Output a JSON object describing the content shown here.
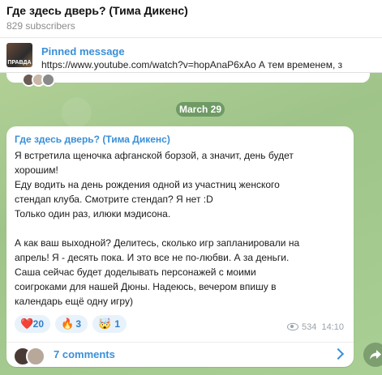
{
  "header": {
    "title": "Где здесь дверь? (Тима Дикенс)",
    "subscribers": "829 subscribers"
  },
  "pinned": {
    "title": "Pinned message",
    "thumb_text": "ПРАВДА",
    "text": "https://www.youtube.com/watch?v=hopAnaP6xAo  А тем временем, з"
  },
  "date_separator": "March 29",
  "message": {
    "author": "Где здесь дверь? (Тима Дикенс)",
    "paragraph1": [
      "Я встретила щеночка афганской борзой, а значит, день будет",
      "хорошим!",
      "Еду водить на день рождения одной из участниц женского",
      "стендап клуба. Смотрите стендап? Я нет :D",
      "Только один раз, илюки мэдисона."
    ],
    "paragraph2": [
      "А как ваш выходной? Делитесь, сколько игр запланировали на",
      "апрель! Я - десять пока. И это все не по-любви. А за деньги.",
      "Саша сейчас будет доделывать персонажей с моими",
      "соигроками для нашей Дюны. Надеюсь, вечером впишу в",
      "календарь ещё одну игру)"
    ],
    "reactions": [
      {
        "emoji": "❤️",
        "count": "20"
      },
      {
        "emoji": "🔥",
        "count": "3"
      },
      {
        "emoji": "🤯",
        "count": "1"
      }
    ],
    "views": "534",
    "time": "14:10",
    "comments_label": "7 comments"
  },
  "colors": {
    "accent": "#3a8fd8",
    "bubble": "#ffffff",
    "date_pill": "#6f9a65"
  },
  "icons": {
    "views": "eye-icon",
    "comments_arrow": "chevron-right-icon",
    "share": "share-arrow-icon"
  }
}
